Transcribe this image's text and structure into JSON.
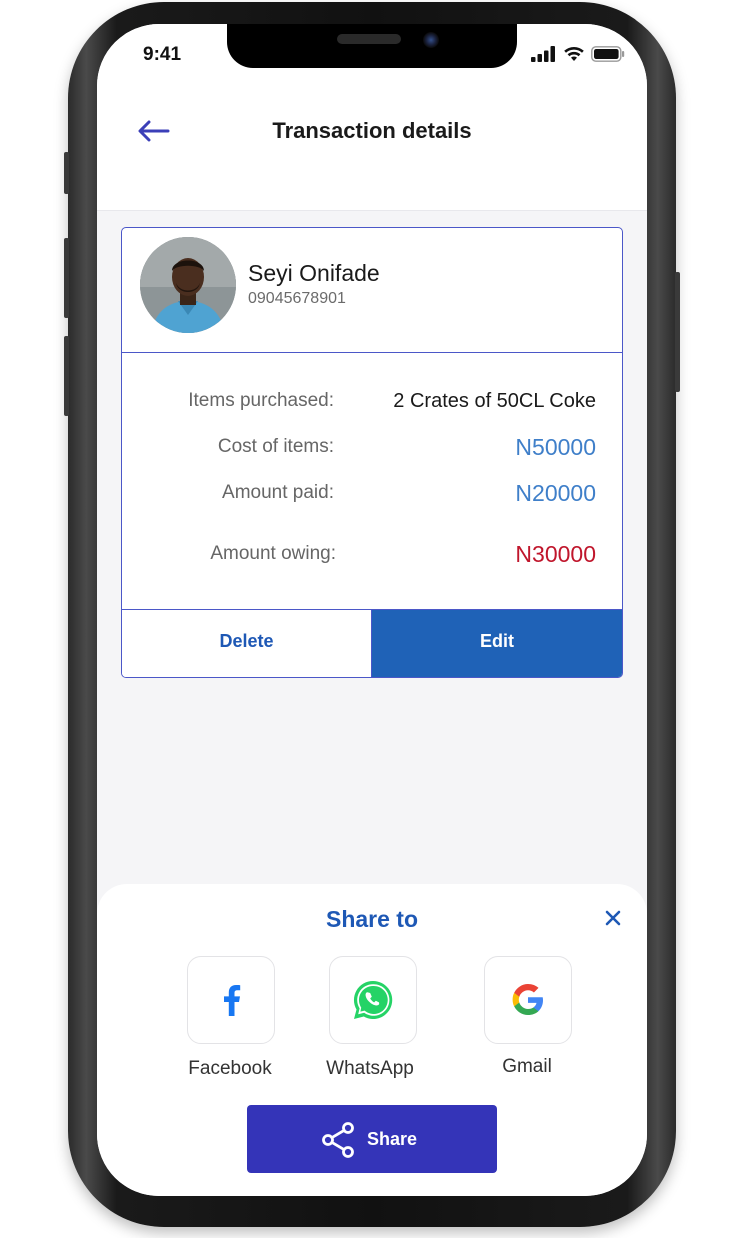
{
  "status_bar": {
    "time": "9:41"
  },
  "header": {
    "title": "Transaction details",
    "back_icon": "arrow-left-icon"
  },
  "customer": {
    "name": "Seyi Onifade",
    "phone": "09045678901"
  },
  "details": {
    "items_label": "Items purchased:",
    "items_value": "2 Crates of 50CL Coke",
    "cost_label": "Cost of items:",
    "cost_value": "N50000",
    "paid_label": "Amount paid:",
    "paid_value": "N20000",
    "owing_label": "Amount owing:",
    "owing_value": "N30000"
  },
  "actions": {
    "delete_label": "Delete",
    "edit_label": "Edit"
  },
  "share_sheet": {
    "title": "Share to",
    "options": [
      {
        "label": "Facebook",
        "icon": "facebook-icon"
      },
      {
        "label": "WhatsApp",
        "icon": "whatsapp-icon"
      },
      {
        "label": "Gmail",
        "icon": "google-icon"
      }
    ],
    "share_button_label": "Share"
  },
  "colors": {
    "accent_blue": "#1f62b7",
    "amount_blue": "#3f7fc9",
    "owing_red": "#c0162c",
    "share_button": "#3434b8",
    "card_border": "#4b57c8"
  }
}
